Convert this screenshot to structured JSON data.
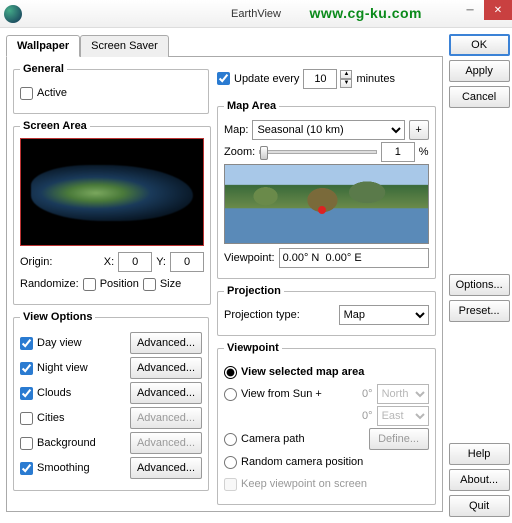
{
  "titlebar": {
    "title": "EarthView"
  },
  "watermark": "www.cg-ku.com",
  "tabs": {
    "wallpaper": "Wallpaper",
    "screensaver": "Screen Saver"
  },
  "general": {
    "legend": "General",
    "active": "Active",
    "update_every": "Update every",
    "update_value": "10",
    "minutes": "minutes"
  },
  "screen_area": {
    "legend": "Screen Area",
    "origin": "Origin:",
    "xlabel": "X:",
    "xval": "0",
    "ylabel": "Y:",
    "yval": "0",
    "randomize": "Randomize:",
    "position": "Position",
    "size": "Size"
  },
  "view_options": {
    "legend": "View Options",
    "items": [
      {
        "label": "Day view",
        "checked": true,
        "enabled": true
      },
      {
        "label": "Night view",
        "checked": true,
        "enabled": true
      },
      {
        "label": "Clouds",
        "checked": true,
        "enabled": true
      },
      {
        "label": "Cities",
        "checked": false,
        "enabled": false
      },
      {
        "label": "Background",
        "checked": false,
        "enabled": false
      },
      {
        "label": "Smoothing",
        "checked": true,
        "enabled": true
      }
    ],
    "advanced": "Advanced..."
  },
  "map_area": {
    "legend": "Map Area",
    "map_label": "Map:",
    "map_value": "Seasonal (10 km)",
    "plus": "+",
    "zoom_label": "Zoom:",
    "zoom_value": "1",
    "zoom_unit": "%",
    "viewpoint_label": "Viewpoint:",
    "viewpoint_value": "0.00° N  0.00° E"
  },
  "projection": {
    "legend": "Projection",
    "type_label": "Projection type:",
    "type_value": "Map"
  },
  "viewpoint": {
    "legend": "Viewpoint",
    "opt_selected": "View selected map area",
    "opt_sun": "View from Sun +",
    "sun_deg1": "0°",
    "sun_dir1": "North",
    "sun_deg2": "0°",
    "sun_dir2": "East",
    "opt_camera": "Camera path",
    "define": "Define...",
    "opt_random": "Random camera position",
    "keep": "Keep viewpoint on screen"
  },
  "side": {
    "ok": "OK",
    "apply": "Apply",
    "cancel": "Cancel",
    "options": "Options...",
    "preset": "Preset...",
    "help": "Help",
    "about": "About...",
    "quit": "Quit"
  }
}
